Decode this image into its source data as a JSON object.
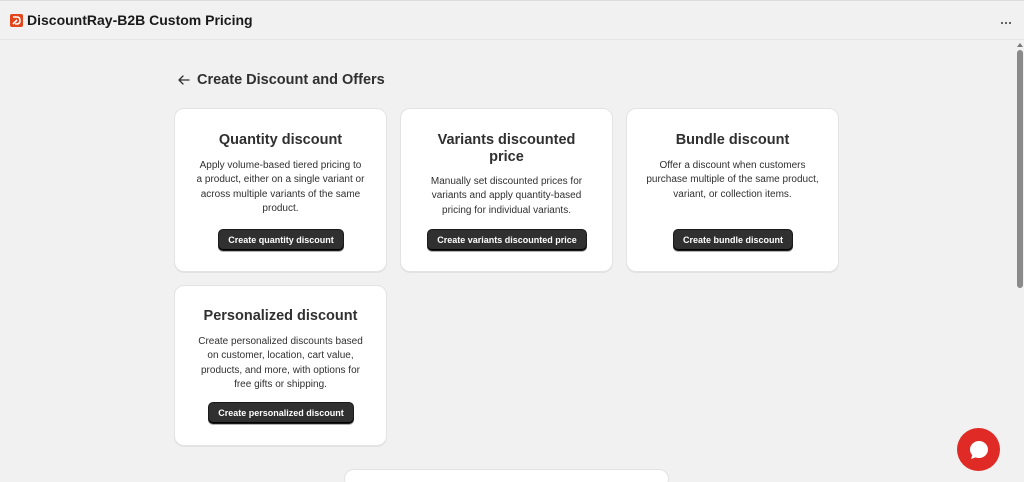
{
  "app": {
    "title": "DiscountRay-B2B Custom Pricing",
    "menu_label": "···"
  },
  "page": {
    "title": "Create Discount and Offers"
  },
  "cards": [
    {
      "title": "Quantity discount",
      "description": "Apply volume-based tiered pricing to a product, either on a single variant or across multiple variants of the same product.",
      "button": "Create quantity discount"
    },
    {
      "title": "Variants discounted price",
      "description": "Manually set discounted prices for variants and apply quantity-based pricing for individual variants.",
      "button": "Create variants discounted price"
    },
    {
      "title": "Bundle discount",
      "description": "Offer a discount when customers purchase multiple of the same product, variant, or collection items.",
      "button": "Create bundle discount"
    },
    {
      "title": "Personalized discount",
      "description": "Create personalized discounts based on customer, location, cart value, products, and more, with options for free gifts or shipping.",
      "button": "Create personalized discount"
    }
  ],
  "colors": {
    "background": "#f1f1f1",
    "card": "#ffffff",
    "button": "#303030",
    "chat": "#e02a25",
    "logo": "#e2451c"
  },
  "icons": {
    "back": "arrow-left-icon",
    "menu": "more-horizontal-icon",
    "chat": "chat-bubble-icon",
    "logo": "app-logo-icon"
  }
}
